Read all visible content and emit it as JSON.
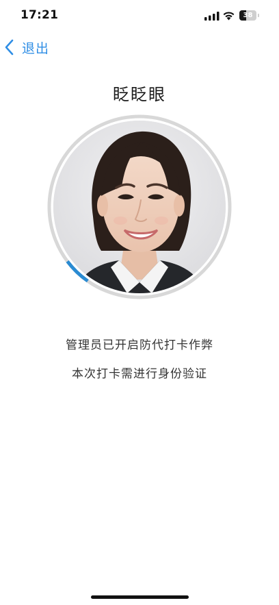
{
  "status_bar": {
    "time": "17:21",
    "battery_level": "38",
    "signal_icon": "cellular-signal-icon",
    "wifi_icon": "wifi-icon",
    "battery_icon": "battery-icon"
  },
  "nav": {
    "back_label": "退出",
    "back_icon": "chevron-left-icon"
  },
  "title": "眨眨眼",
  "verification": {
    "progress_fraction": 0.05,
    "ring_color": "#d8d8d8",
    "progress_color": "#2a8bd2"
  },
  "messages": {
    "line1": "管理员已开启防代打卡作弊",
    "line2": "本次打卡需进行身份验证"
  },
  "colors": {
    "accent": "#2f8ee5",
    "background": "#ffffff"
  }
}
